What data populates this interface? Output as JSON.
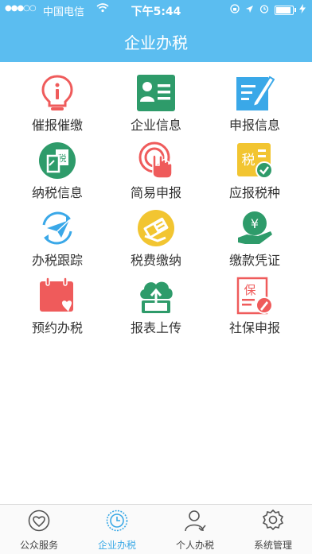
{
  "status": {
    "signal": "●●●○○",
    "carrier": "中国电信",
    "time": "下午5:44"
  },
  "header": {
    "title": "企业办税"
  },
  "grid": {
    "items": [
      {
        "label": "催报催缴",
        "icon": "lightbulb-info-icon"
      },
      {
        "label": "企业信息",
        "icon": "id-card-icon"
      },
      {
        "label": "申报信息",
        "icon": "edit-document-icon"
      },
      {
        "label": "纳税信息",
        "icon": "tax-documents-icon"
      },
      {
        "label": "简易申报",
        "icon": "touch-tap-icon"
      },
      {
        "label": "应报税种",
        "icon": "tax-check-icon"
      },
      {
        "label": "办税跟踪",
        "icon": "paper-plane-icon"
      },
      {
        "label": "税费缴纳",
        "icon": "payment-card-icon"
      },
      {
        "label": "缴款凭证",
        "icon": "yuan-hand-icon"
      },
      {
        "label": "预约办税",
        "icon": "calendar-heart-icon"
      },
      {
        "label": "报表上传",
        "icon": "cloud-upload-icon"
      },
      {
        "label": "社保申报",
        "icon": "social-security-icon"
      }
    ]
  },
  "tabs": [
    {
      "label": "公众服务",
      "icon": "heart-icon"
    },
    {
      "label": "企业办税",
      "icon": "clock-badge-icon"
    },
    {
      "label": "个人办税",
      "icon": "person-icon"
    },
    {
      "label": "系统管理",
      "icon": "gear-icon"
    }
  ],
  "colors": {
    "accent": "#5bbdf0",
    "active_tab": "#3ba9e6"
  }
}
